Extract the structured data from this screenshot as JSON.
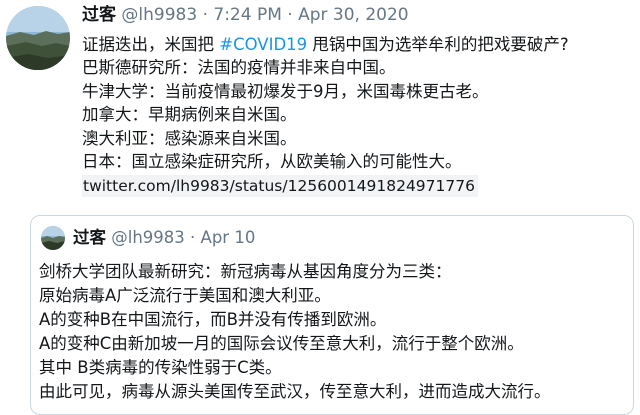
{
  "tweet": {
    "author_name": "过客",
    "handle": "@lh9983",
    "separator": "·",
    "time": "7:24 PM",
    "date": "Apr 30, 2020",
    "line1_before": "证据迭出，米国把 ",
    "hashtag": "#COVID19",
    "line1_after": " 甩锅中国为选举牟利的把戏要破产?",
    "lines": [
      "巴斯德研究所：法国的疫情并非来自中国。",
      "牛津大学：当前疫情最初爆发于9月，米国毒株更古老。",
      "加拿大：早期病例来自米国。",
      "澳大利亚：感染源来自米国。",
      "日本：国立感染症研究所，从欧美输入的可能性大。"
    ],
    "link_text": "twitter.com/lh9983/status/1256001491824971776"
  },
  "quoted": {
    "author_name": "过客",
    "handle": "@lh9983",
    "separator": "·",
    "date": "Apr 10",
    "lines": [
      "剑桥大学团队最新研究：新冠病毒从基因角度分为三类：",
      "原始病毒A广泛流行于美国和澳大利亚。",
      "A的变种B在中国流行，而B并没有传播到欧洲。",
      "A的变种C由新加坡一月的国际会议传至意大利，流行于整个欧洲。",
      "其中 B类病毒的传染性弱于C类。",
      "由此可见，病毒从源头美国传至武汉，传至意大利，进而造成大流行。"
    ]
  }
}
